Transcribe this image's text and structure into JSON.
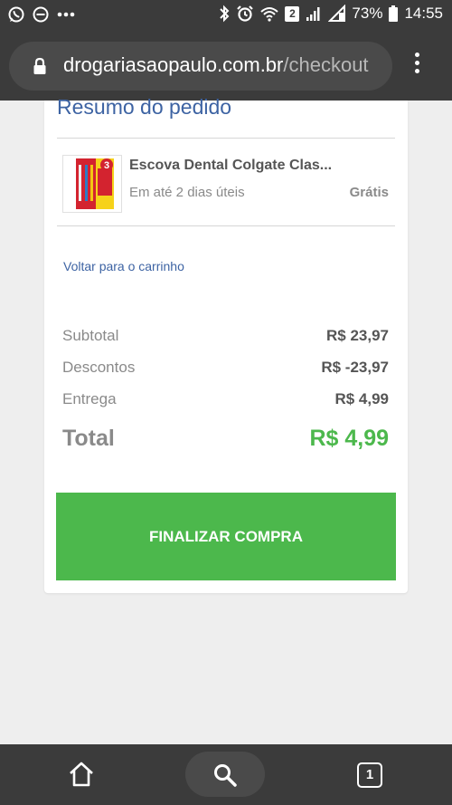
{
  "status_bar": {
    "battery": "73%",
    "time": "14:55",
    "notification_count": "2"
  },
  "browser": {
    "url_domain": "drogariasaopaulo.com.br",
    "url_path": "/checkout",
    "open_tabs": "1"
  },
  "order_summary": {
    "title": "Resumo do pedido",
    "item": {
      "name": "Escova Dental Colgate Clas...",
      "delivery": "Em até 2 dias úteis",
      "shipping_price": "Grátis",
      "pack_count": "3"
    },
    "back_link": "Voltar para o carrinho",
    "subtotal_label": "Subtotal",
    "subtotal_value": "R$ 23,97",
    "discount_label": "Descontos",
    "discount_value": "R$ -23,97",
    "shipping_label": "Entrega",
    "shipping_value": "R$ 4,99",
    "total_label": "Total",
    "total_value": "R$ 4,99",
    "checkout_button": "FINALIZAR COMPRA"
  },
  "colors": {
    "accent_blue": "#3d63a3",
    "accent_green": "#4cb84c",
    "chrome_dark": "#3b3b3b"
  },
  "icons": [
    "whatsapp-icon",
    "dnd-icon",
    "more-notifications-icon",
    "bluetooth-icon",
    "alarm-icon",
    "wifi-icon",
    "signal-icon",
    "battery-icon",
    "lock-icon",
    "menu-icon",
    "home-icon",
    "search-icon",
    "tabs-icon"
  ]
}
